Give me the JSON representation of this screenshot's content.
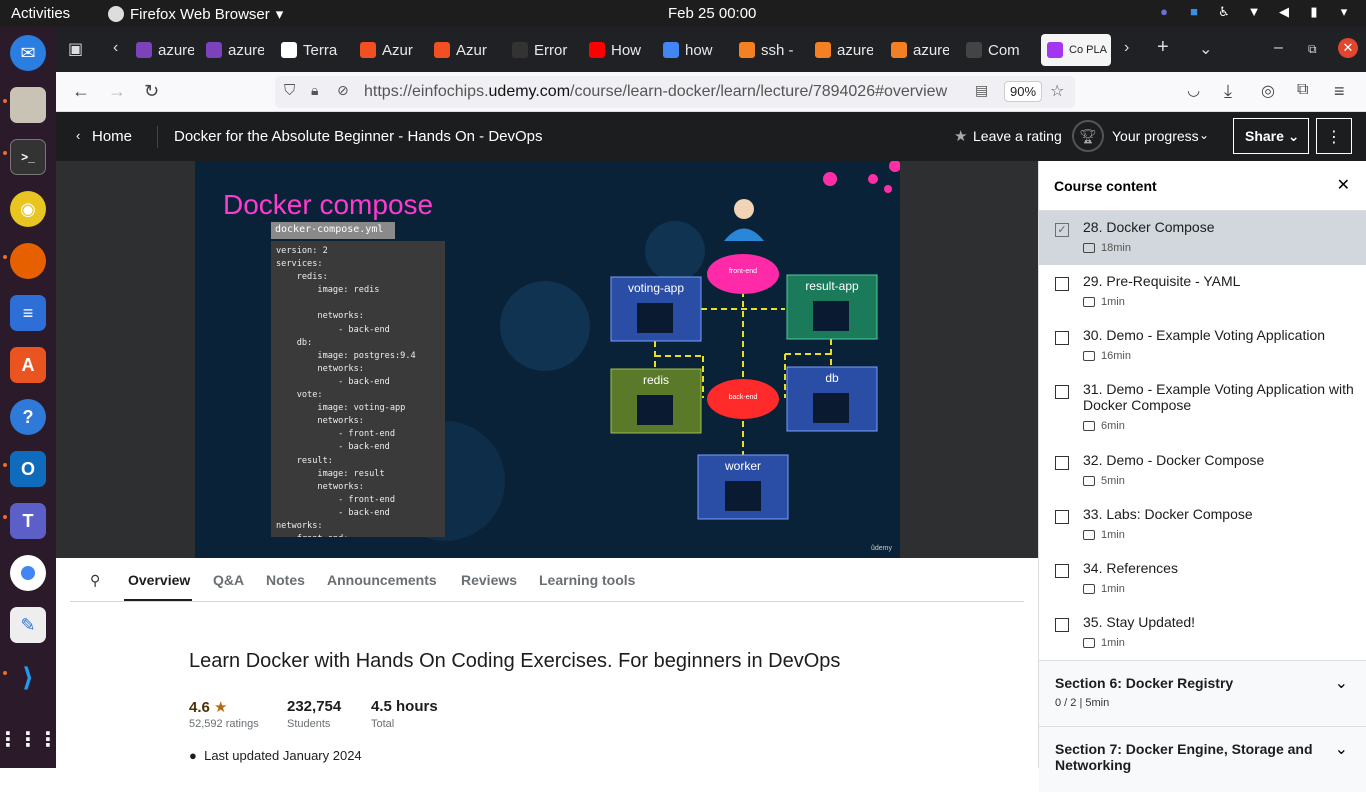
{
  "topbar": {
    "activities": "Activities",
    "app_name": "Firefox Web Browser",
    "clock": "Feb 25  00:00"
  },
  "browser": {
    "tabs": [
      {
        "label": "azure",
        "color": "#7b42bc"
      },
      {
        "label": "azure",
        "color": "#7b42bc"
      },
      {
        "label": "Terra",
        "color": "#ffffff"
      },
      {
        "label": "Azur",
        "color": "#f25022"
      },
      {
        "label": "Azur",
        "color": "#f25022"
      },
      {
        "label": "Error",
        "color": "#333333"
      },
      {
        "label": "How",
        "color": "#ff0000"
      },
      {
        "label": "how",
        "color": "#4285f4"
      },
      {
        "label": "ssh -",
        "color": "#f48024"
      },
      {
        "label": "azure",
        "color": "#f48024"
      },
      {
        "label": "azure",
        "color": "#f48024"
      },
      {
        "label": "Com",
        "color": "#444444"
      },
      {
        "label": "Co PLA",
        "color": "#a435f0"
      }
    ],
    "url_prefix": "https://einfochips.",
    "url_domain": "udemy.com",
    "url_path": "/course/learn-docker/learn/lecture/7894026#overview",
    "zoom": "90%"
  },
  "udemy": {
    "home": "Home",
    "course_title": "Docker for the Absolute Beginner - Hands On - DevOps",
    "rating_btn": "Leave a rating",
    "progress_btn": "Your progress",
    "share_btn": "Share"
  },
  "slide": {
    "title": "Docker compose",
    "file_label": "docker-compose.yml",
    "yaml": "version: 2\nservices:\n    redis:\n        image: redis\n\n        networks:\n            - back-end\n    db:\n        image: postgres:9.4\n        networks:\n            - back-end\n    vote:\n        image: voting-app\n        networks:\n            - front-end\n            - back-end\n    result:\n        image: result\n        networks:\n            - front-end\n            - back-end\nnetworks:\n    front-end:\n    back-end:",
    "nodes": {
      "voting": "voting-app",
      "result": "result-app",
      "redis": "redis",
      "db": "db",
      "worker": "worker",
      "front": "front-end",
      "back": "back-end"
    },
    "watermark": "ûdemy"
  },
  "lecture_tabs": [
    "Overview",
    "Q&A",
    "Notes",
    "Announcements",
    "Reviews",
    "Learning tools"
  ],
  "overview": {
    "headline": "Learn Docker with Hands On Coding Exercises. For beginners in DevOps",
    "rating": "4.6",
    "ratings_count": "52,592 ratings",
    "students": "232,754",
    "students_label": "Students",
    "hours": "4.5 hours",
    "hours_label": "Total",
    "updated": "Last updated January 2024"
  },
  "sidebar": {
    "title": "Course content",
    "lectures": [
      {
        "title": "28. Docker Compose",
        "duration": "18min",
        "checked": true
      },
      {
        "title": "29. Pre-Requisite - YAML",
        "duration": "1min",
        "checked": false
      },
      {
        "title": "30. Demo - Example Voting Application",
        "duration": "16min",
        "checked": false
      },
      {
        "title": "31. Demo - Example Voting Application with Docker Compose",
        "duration": "6min",
        "checked": false
      },
      {
        "title": "32. Demo - Docker Compose",
        "duration": "5min",
        "checked": false
      },
      {
        "title": "33. Labs: Docker Compose",
        "duration": "1min",
        "checked": false
      },
      {
        "title": "34. References",
        "duration": "1min",
        "checked": false
      },
      {
        "title": "35. Stay Updated!",
        "duration": "1min",
        "checked": false
      }
    ],
    "sections": [
      {
        "title": "Section 6: Docker Registry",
        "sub": "0 / 2 | 5min"
      },
      {
        "title": "Section 7: Docker Engine, Storage and Networking",
        "sub": ""
      }
    ]
  }
}
